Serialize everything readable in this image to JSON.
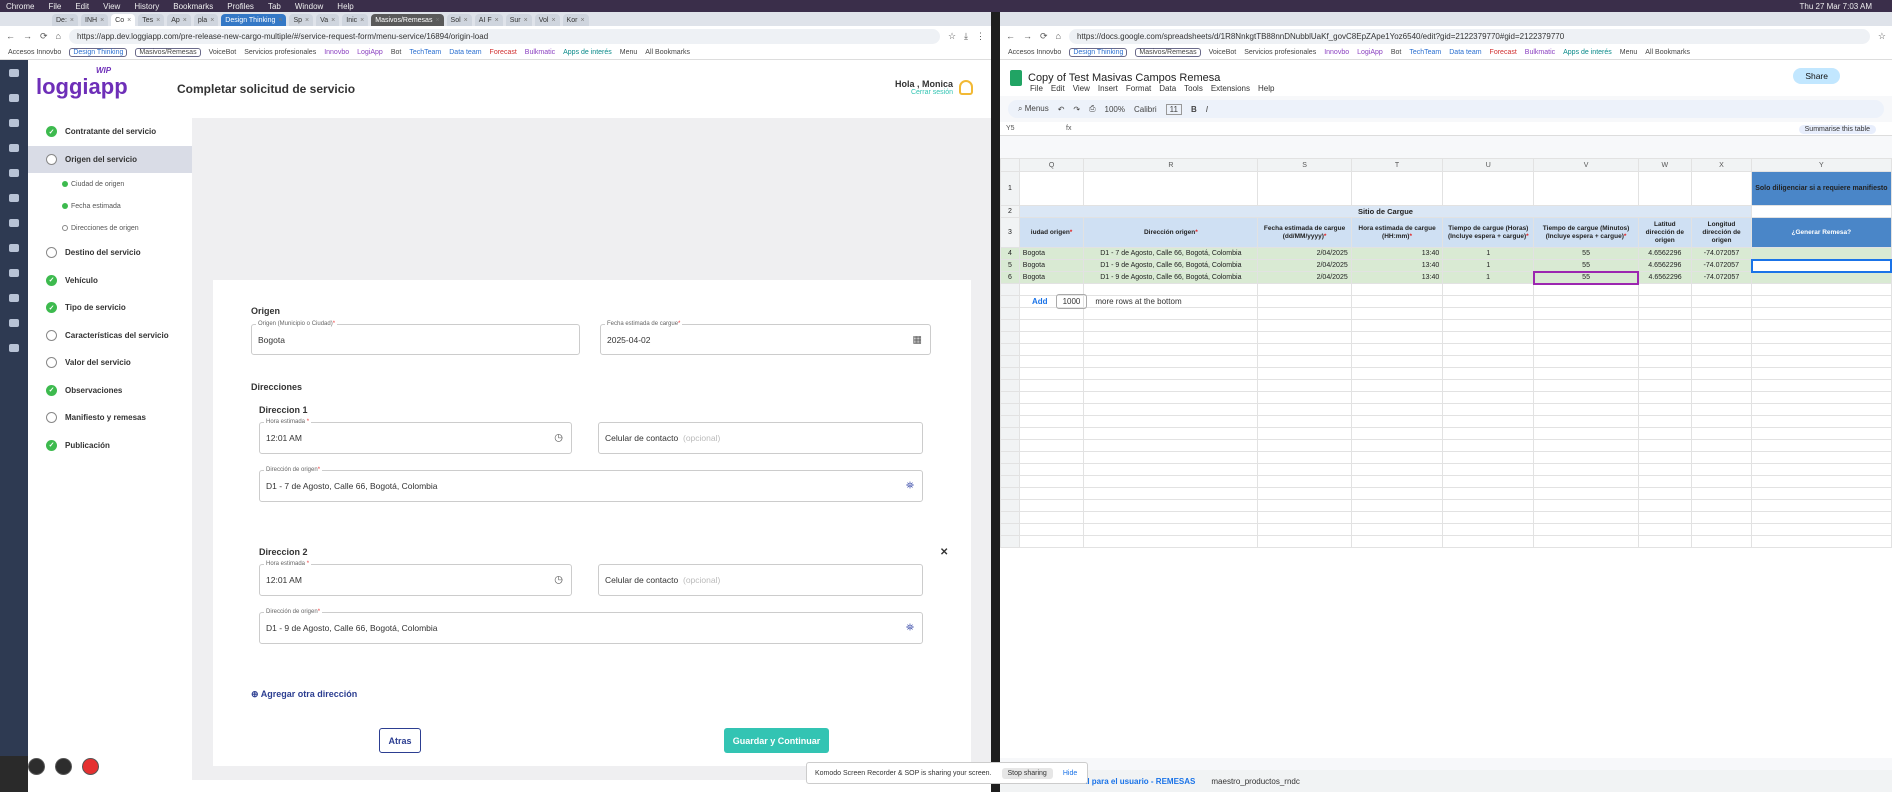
{
  "menubar": {
    "items": [
      "Chrome",
      "File",
      "Edit",
      "View",
      "History",
      "Bookmarks",
      "Profiles",
      "Tab",
      "Window",
      "Help"
    ],
    "clock": "Thu 27 Mar 7:03 AM"
  },
  "left_browser": {
    "tabs": [
      "De:",
      "INH",
      "Co",
      "Tes",
      "Ap",
      "pla",
      "Design Thinking",
      "Sp",
      "Va",
      "Inic",
      "Masivos/Remesas",
      "Sol",
      "AI F",
      "Sur",
      "Vol",
      "Kor"
    ],
    "url": "https://app.dev.loggiapp.com/pre-release-new-cargo-multiple/#/service-request-form/menu-service/16894/origin-load",
    "bookmarks": [
      "Accesos Innovbo",
      "Design Thinking",
      "Masivos/Remesas",
      "VoiceBot",
      "Servicios profesionales",
      "Innovbo",
      "LogiApp",
      "Bot",
      "TechTeam",
      "Data team",
      "Forecast",
      "Bulkmatic",
      "Apps de interés",
      "Menu",
      "All Bookmarks"
    ]
  },
  "app": {
    "logo": "loggiapp",
    "logo_tag": "WIP",
    "title": "Completar solicitud de servicio",
    "greeting": "Hola , Monica",
    "logout": "Cerrar sesión",
    "steps": [
      {
        "label": "Contratante del servicio",
        "done": true
      },
      {
        "label": "Origen del servicio",
        "done": false,
        "current": true
      },
      {
        "label": "Destino del servicio",
        "done": false
      },
      {
        "label": "Vehículo",
        "done": true
      },
      {
        "label": "Tipo de servicio",
        "done": true
      },
      {
        "label": "Características del servicio",
        "done": false
      },
      {
        "label": "Valor del servicio",
        "done": false
      },
      {
        "label": "Observaciones",
        "done": true
      },
      {
        "label": "Manifiesto y remesas",
        "done": false
      },
      {
        "label": "Publicación",
        "done": true
      }
    ],
    "substeps": [
      {
        "label": "Ciudad de origen",
        "done": true
      },
      {
        "label": "Fecha estimada",
        "done": true
      },
      {
        "label": "Direcciones de origen",
        "done": false
      }
    ],
    "form": {
      "origen_heading": "Origen",
      "origen_label": "Origen (Municipio o Ciudad)",
      "origen_value": "Bogota",
      "fecha_label": "Fecha estimada de cargue",
      "fecha_value": "2025-04-02",
      "direcciones_heading": "Direcciones",
      "dir1_heading": "Direccion 1",
      "dir2_heading": "Direccion 2",
      "hora_label": "Hora estimada",
      "dir1_hora": "12:01  AM",
      "dir2_hora": "12:01  AM",
      "celular_label": "Celular de contacto",
      "celular_opt": "(opcional)",
      "dir_label": "Dirección de origen",
      "dir1_value": "D1 - 7 de Agosto, Calle 66, Bogotá, Colombia",
      "dir2_value": "D1 - 9 de Agosto, Calle 66, Bogotá, Colombia",
      "add_dir": "Agregar otra dirección",
      "back": "Atras",
      "save": "Guardar y Continuar"
    }
  },
  "sheets": {
    "url": "https://docs.google.com/spreadsheets/d/1R8NnkgtTB88nnDNubblUaKf_govC8EpZApe1Yoz6540/edit?gid=2122379770#gid=2122379770",
    "title": "Copy of Test Masivas Campos Remesa",
    "menu": [
      "File",
      "Edit",
      "View",
      "Insert",
      "Format",
      "Data",
      "Tools",
      "Extensions",
      "Help"
    ],
    "share": "Share",
    "toolbar": {
      "menus": "Menus",
      "zoom": "100%",
      "font": "Calibri",
      "size": "11"
    },
    "cellref": "Y5",
    "summarise": "Summarise this table",
    "columns": [
      "Q",
      "R",
      "S",
      "T",
      "U",
      "V",
      "W",
      "X",
      "Y"
    ],
    "row1_note": "Solo diligenciar si a requiere manifiesto",
    "group_header": "Sitio de Cargue",
    "headers": [
      {
        "t": "iudad origen",
        "req": "*"
      },
      {
        "t": "Dirección origen",
        "req": "*"
      },
      {
        "t": "Fecha estimada de cargue (dd/MM/yyyy)",
        "req": "*"
      },
      {
        "t": "Hora estimada de cargue (HH:mm)",
        "req": "*"
      },
      {
        "t": "Tiempo de cargue (Horas) (Incluye espera + cargue)",
        "req": "*"
      },
      {
        "t": "Tiempo de cargue (Minutos) (Incluye espera + cargue)",
        "req": "*"
      },
      {
        "t": "Latitud dirección de origen",
        "req": ""
      },
      {
        "t": "Longitud dirección de origen",
        "req": ""
      },
      {
        "t": "¿Generar Remesa?",
        "req": ""
      }
    ],
    "rows": [
      {
        "n": "4",
        "city": "Bogota",
        "dir": "D1 - 7 de Agosto, Calle 66, Bogotá, Colombia",
        "fecha": "2/04/2025",
        "hora": "13:40",
        "horas": "1",
        "min": "55",
        "lat": "4.6562296",
        "lng": "-74.072057"
      },
      {
        "n": "5",
        "city": "Bogota",
        "dir": "D1 - 9 de Agosto, Calle 66, Bogotá, Colombia",
        "fecha": "2/04/2025",
        "hora": "13:40",
        "horas": "1",
        "min": "55",
        "lat": "4.6562296",
        "lng": "-74.072057"
      },
      {
        "n": "6",
        "city": "Bogota",
        "dir": "D1 - 9 de Agosto, Calle 66, Bogotá, Colombia",
        "fecha": "2/04/2025",
        "hora": "13:40",
        "horas": "1",
        "min": "55",
        "lat": "4.6562296",
        "lng": "-74.072057"
      }
    ],
    "add_label": "Add",
    "add_count": "1000",
    "add_suffix": "more rows at the bottom",
    "sheet_tabs": [
      "ual para el usuario - REMESAS",
      "maestro_productos_rndc"
    ]
  },
  "sharebar": {
    "text": "Komodo Screen Recorder & SOP is sharing your screen.",
    "stop": "Stop sharing",
    "hide": "Hide"
  }
}
